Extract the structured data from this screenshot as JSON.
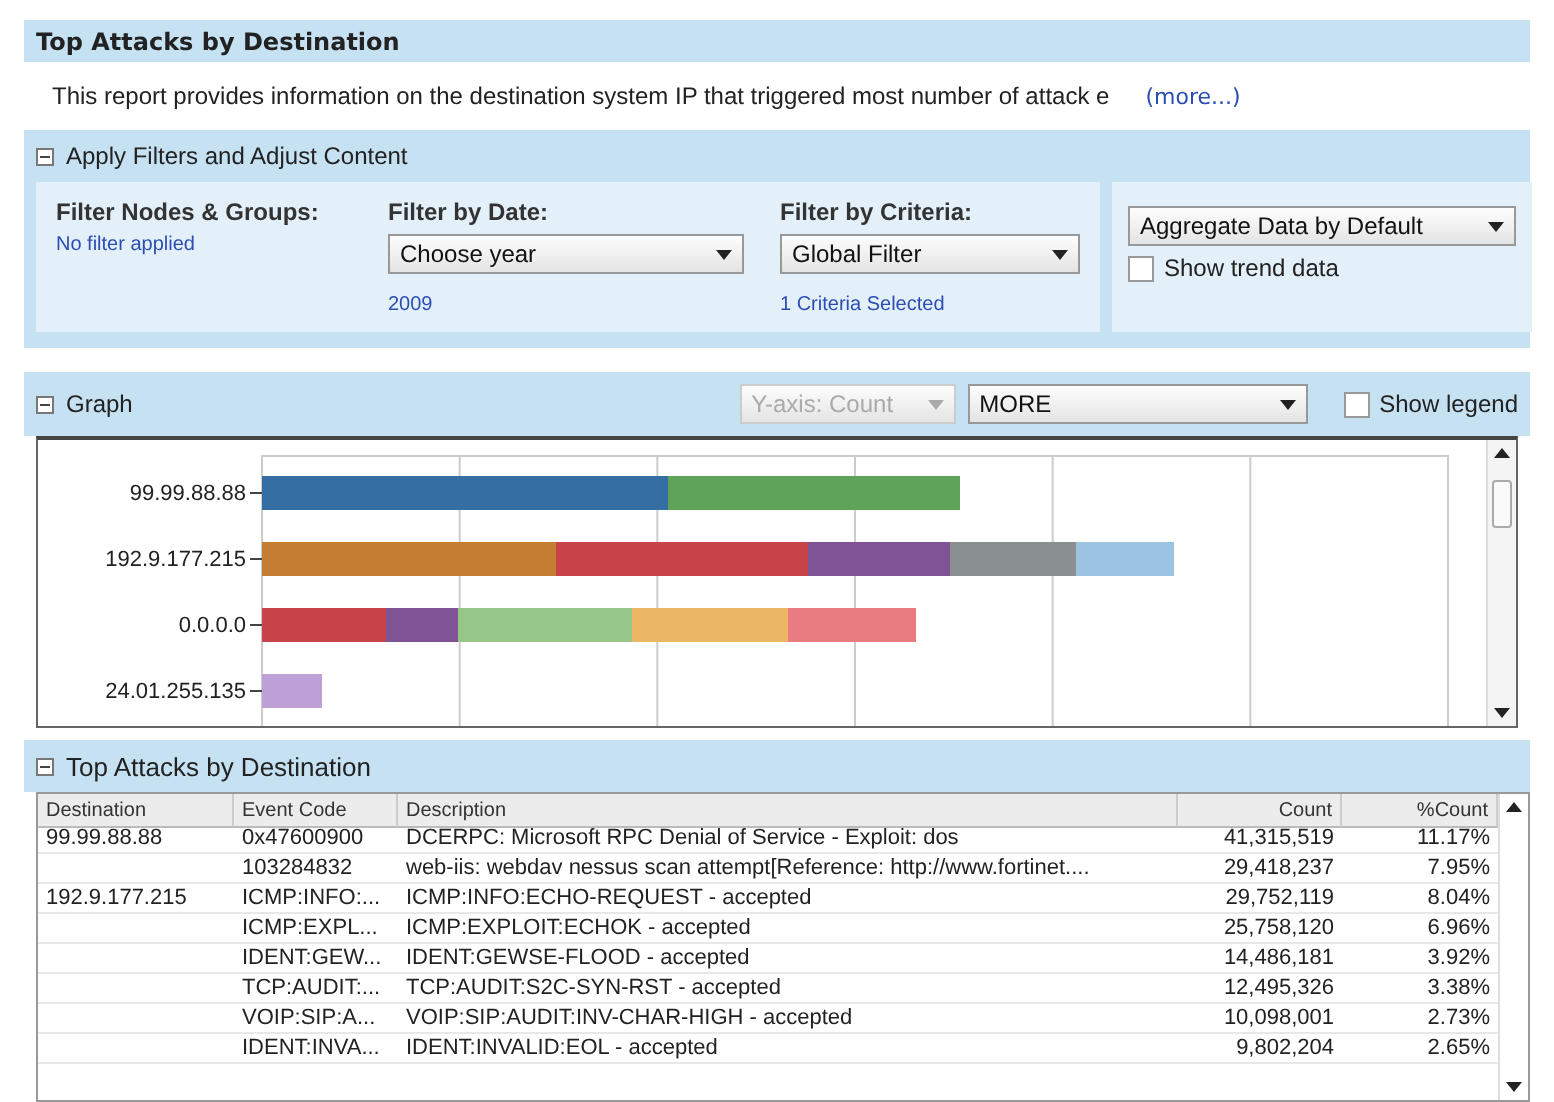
{
  "report": {
    "title": "Top Attacks by Destination",
    "description": "This report provides information on the destination system IP that triggered most number of attack e",
    "more_link": "(more...)"
  },
  "filters": {
    "header": "Apply Filters and Adjust Content",
    "expanded": true,
    "nodes": {
      "label": "Filter Nodes & Groups:",
      "value": "No filter applied"
    },
    "date": {
      "label": "Filter by Date:",
      "select": "Choose year",
      "value": "2009"
    },
    "criteria": {
      "label": "Filter by Criteria:",
      "select": "Global Filter",
      "value": "1 Criteria Selected"
    },
    "aggregate": {
      "select": "Aggregate Data by Default"
    },
    "trend": {
      "label": "Show trend data",
      "checked": false
    }
  },
  "graph": {
    "header": "Graph",
    "expanded": true,
    "yaxis": {
      "select": "Y-axis: Count",
      "disabled": true
    },
    "more": {
      "select": "MORE"
    },
    "legend": {
      "label": "Show legend",
      "checked": false
    },
    "bars": [
      {
        "label": "99.99.88.88",
        "segments": [
          {
            "color": "#356ea3"
          },
          {
            "color": "#5fa35a"
          }
        ]
      },
      {
        "label": "192.9.177.215",
        "segments": [
          {
            "color": "#c57c33"
          },
          {
            "color": "#c9434b"
          },
          {
            "color": "#7f5497"
          },
          {
            "color": "#8a8f90"
          },
          {
            "color": "#9dc3e3"
          }
        ]
      },
      {
        "label": "0.0.0.0",
        "segments": [
          {
            "color": "#c9434b"
          },
          {
            "color": "#7f5497"
          },
          {
            "color": "#96c788"
          },
          {
            "color": "#ecb765"
          },
          {
            "color": "#e87c80"
          }
        ]
      },
      {
        "label": "24.01.255.135",
        "segments": [
          {
            "color": "#bfa0d6"
          }
        ]
      }
    ]
  },
  "table": {
    "header": "Top Attacks by Destination",
    "expanded": true,
    "columns": [
      "Destination",
      "Event Code",
      "Description",
      "Count",
      "%Count"
    ],
    "rows": [
      [
        "99.99.88.88",
        "0x47600900",
        "DCERPC: Microsoft RPC Denial of Service - Exploit: dos",
        "41,315,519",
        "11.17%"
      ],
      [
        "",
        "103284832",
        "web-iis: webdav nessus scan attempt[Reference: http://www.fortinet....",
        "29,418,237",
        "7.95%"
      ],
      [
        "192.9.177.215",
        "ICMP:INFO:...",
        "ICMP:INFO:ECHO-REQUEST - accepted",
        "29,752,119",
        "8.04%"
      ],
      [
        "",
        "ICMP:EXPL...",
        "ICMP:EXPLOIT:ECHOK - accepted",
        "25,758,120",
        "6.96%"
      ],
      [
        "",
        "IDENT:GEW...",
        "IDENT:GEWSE-FLOOD - accepted",
        "14,486,181",
        "3.92%"
      ],
      [
        "",
        "TCP:AUDIT:...",
        "TCP:AUDIT:S2C-SYN-RST - accepted",
        "12,495,326",
        "3.38%"
      ],
      [
        "",
        "VOIP:SIP:A...",
        "VOIP:SIP:AUDIT:INV-CHAR-HIGH - accepted",
        "10,098,001",
        "2.73%"
      ],
      [
        "",
        "IDENT:INVA...",
        "IDENT:INVALID:EOL - accepted",
        "9,802,204",
        "2.65%"
      ]
    ]
  }
}
